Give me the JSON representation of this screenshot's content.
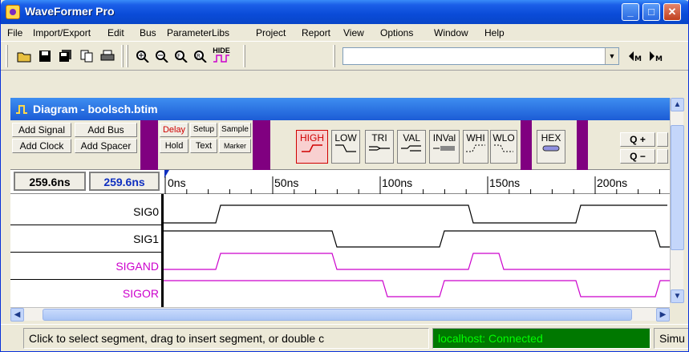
{
  "window": {
    "title": "WaveFormer Pro"
  },
  "menu": [
    "File",
    "Import/Export",
    "Edit",
    "Bus",
    "ParameterLibs",
    "Project",
    "Report",
    "View",
    "Options",
    "Window",
    "Help"
  ],
  "toolbar": {
    "icons": [
      "open-folder-icon",
      "save-icon",
      "save-all-icon",
      "copy-icon",
      "print-icon",
      "zoom-in-icon",
      "zoom-out-icon",
      "zoom-fit-icon",
      "zoom-range-icon"
    ],
    "hide_label": "HIDE",
    "combo_value": ""
  },
  "diagram": {
    "title": "Diagram - boolsch.btim",
    "buttons": {
      "add_signal": "Add Signal",
      "add_bus": "Add Bus",
      "add_clock": "Add Clock",
      "add_spacer": "Add Spacer",
      "delay": "Delay",
      "setup": "Setup",
      "sample": "Sample",
      "hold": "Hold",
      "text": "Text",
      "marker": "Marker",
      "high": "HIGH",
      "low": "LOW",
      "tri": "TRI",
      "val": "VAL",
      "inval": "INVal",
      "whi": "WHI",
      "wlo": "WLO",
      "hex": "HEX",
      "zoom_in": "Q +",
      "zoom_out": "Q −"
    },
    "time_left": "259.6ns",
    "time_right": "259.6ns",
    "ticks": [
      "0ns",
      "50ns",
      "100ns",
      "150ns",
      "200ns"
    ],
    "signals": [
      {
        "name": "SIG0",
        "color": "#000000"
      },
      {
        "name": "SIG1",
        "color": "#000000"
      },
      {
        "name": "SIGAND",
        "color": "#CC00CC"
      },
      {
        "name": "SIGOR",
        "color": "#CC00CC"
      }
    ]
  },
  "status": {
    "message": "Click to select segment, drag to insert segment, or double c",
    "connection": "localhost: Connected",
    "right": "Simu"
  },
  "colors": {
    "connected_bg": "#007800",
    "connected_fg": "#00FF00",
    "signal_magenta": "#CC00CC",
    "purple_divider": "#800080"
  }
}
